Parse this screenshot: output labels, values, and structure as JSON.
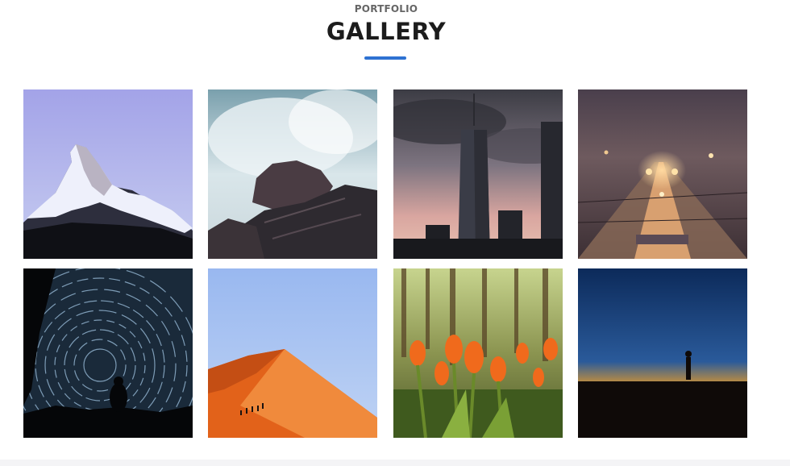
{
  "section": {
    "eyebrow": "PORTFOLIO",
    "title": "GALLERY",
    "accent_color": "#2e72d2"
  },
  "gallery": {
    "items": [
      {
        "subject": "snowy mountain peak (Matterhorn) against a purple-blue sky"
      },
      {
        "subject": "ocean wave crashing over dark rocks"
      },
      {
        "subject": "city skyscraper at dusk under cloudy sky"
      },
      {
        "subject": "foggy railway lines with glowing lights at night"
      },
      {
        "subject": "star trails swirling over a silhouetted figure"
      },
      {
        "subject": "people walking on an orange sand dune under blue sky"
      },
      {
        "subject": "orange tulips in a forest at sunset"
      },
      {
        "subject": "silhouette of a person at twilight horizon"
      }
    ]
  }
}
